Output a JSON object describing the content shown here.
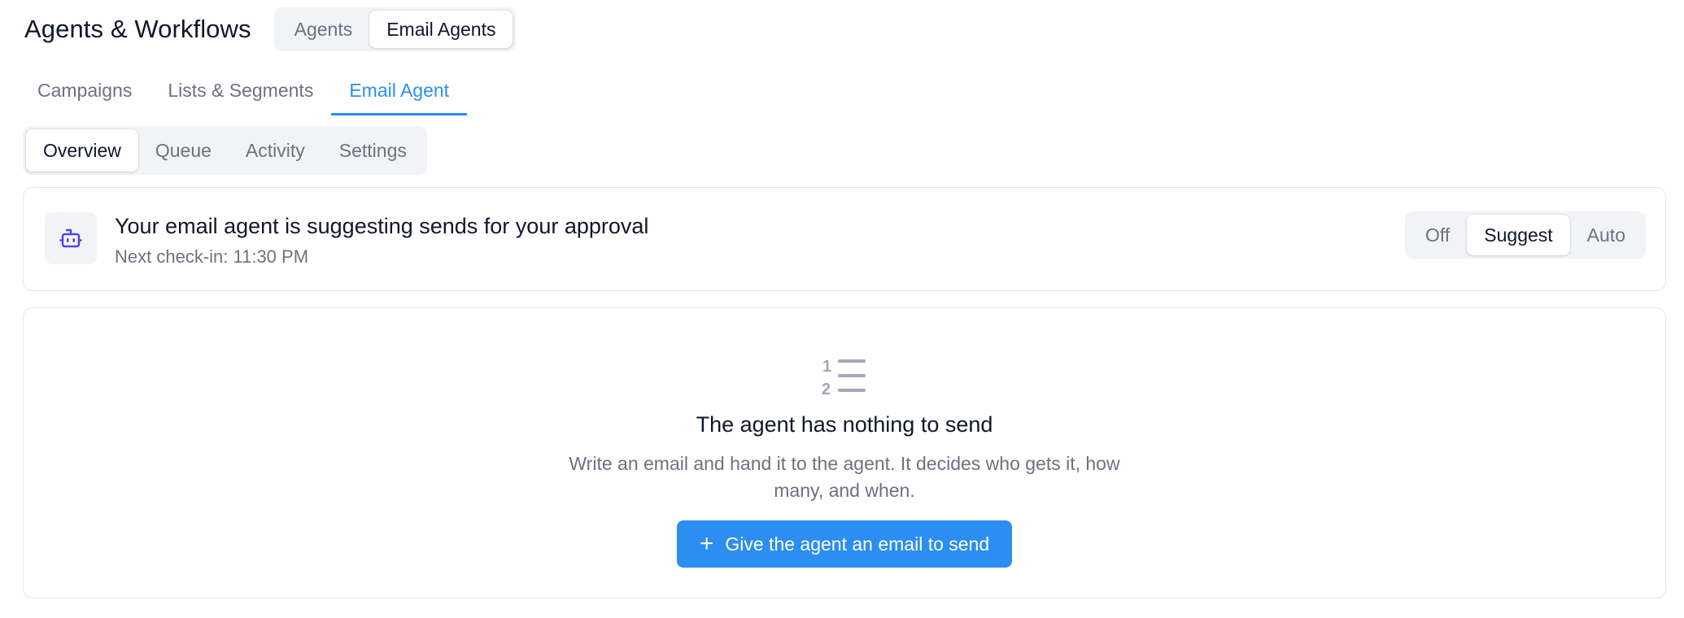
{
  "header": {
    "title": "Agents & Workflows",
    "switch": [
      {
        "label": "Agents",
        "active": false
      },
      {
        "label": "Email Agents",
        "active": true
      }
    ]
  },
  "main_tabs": [
    {
      "label": "Campaigns",
      "active": false
    },
    {
      "label": "Lists & Segments",
      "active": false
    },
    {
      "label": "Email Agent",
      "active": true
    }
  ],
  "sub_tabs": [
    {
      "label": "Overview",
      "active": true
    },
    {
      "label": "Queue",
      "active": false
    },
    {
      "label": "Activity",
      "active": false
    },
    {
      "label": "Settings",
      "active": false
    }
  ],
  "status": {
    "icon": "robot-icon",
    "title": "Your email agent is suggesting sends for your approval",
    "subtitle": "Next check-in: 11:30 PM",
    "modes": [
      {
        "label": "Off",
        "active": false
      },
      {
        "label": "Suggest",
        "active": true
      },
      {
        "label": "Auto",
        "active": false
      }
    ]
  },
  "empty_state": {
    "icon": "numbered-list-icon",
    "title": "The agent has nothing to send",
    "description": "Write an email and hand it to the agent. It decides who gets it, how many, and when.",
    "button_icon": "plus-icon",
    "button_label": "Give the agent an email to send"
  },
  "colors": {
    "accent": "#2b8ef0",
    "text_primary": "#0f172a",
    "text_muted": "#6b7280",
    "segment_bg": "#f1f3f6",
    "border": "#e3e6ea"
  }
}
